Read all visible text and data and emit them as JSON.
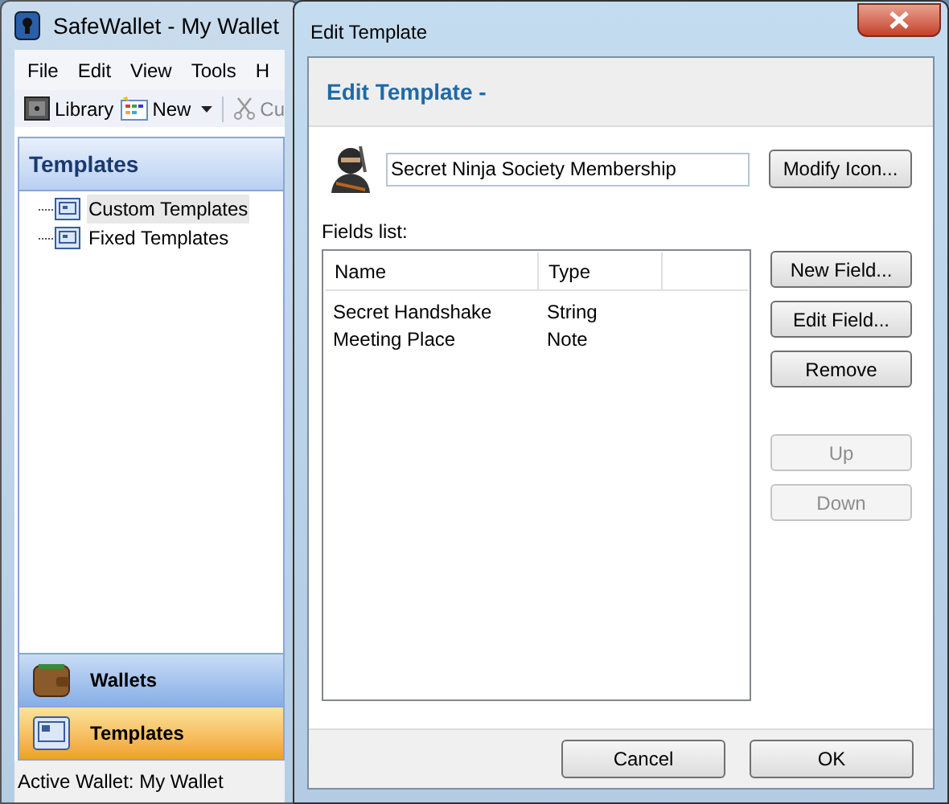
{
  "main_window": {
    "title": "SafeWallet - My Wallet",
    "menu": [
      "File",
      "Edit",
      "View",
      "Tools",
      "H"
    ],
    "toolbar": [
      {
        "kind": "library",
        "label": "Library"
      },
      {
        "kind": "new",
        "label": "New"
      },
      {
        "kind": "cut",
        "label": "Cu"
      }
    ],
    "sidebar": {
      "title": "Templates",
      "tree": [
        {
          "label": "Custom Templates",
          "selected": true
        },
        {
          "label": "Fixed Templates",
          "selected": false
        }
      ],
      "nav": [
        {
          "kind": "wallet",
          "label": "Wallets",
          "selected": false
        },
        {
          "kind": "template",
          "label": "Templates",
          "selected": true
        }
      ]
    },
    "status_bar": "Active Wallet: My Wallet"
  },
  "dialog": {
    "title": "Edit Template",
    "heading": "Edit Template -",
    "name_value": "Secret Ninja Society Membership",
    "modify_icon_button": "Modify Icon...",
    "fields_label": "Fields list:",
    "columns": [
      "Name",
      "Type"
    ],
    "rows": [
      {
        "name": "Secret Handshake",
        "type": "String"
      },
      {
        "name": "Meeting Place",
        "type": "Note"
      }
    ],
    "side_buttons": [
      {
        "label": "New Field...",
        "disabled": false
      },
      {
        "label": "Edit Field...",
        "disabled": false
      },
      {
        "label": "Remove",
        "disabled": false
      },
      {
        "label": "Up",
        "disabled": true
      },
      {
        "label": "Down",
        "disabled": true
      }
    ],
    "footer_buttons": [
      "Cancel",
      "OK"
    ]
  }
}
